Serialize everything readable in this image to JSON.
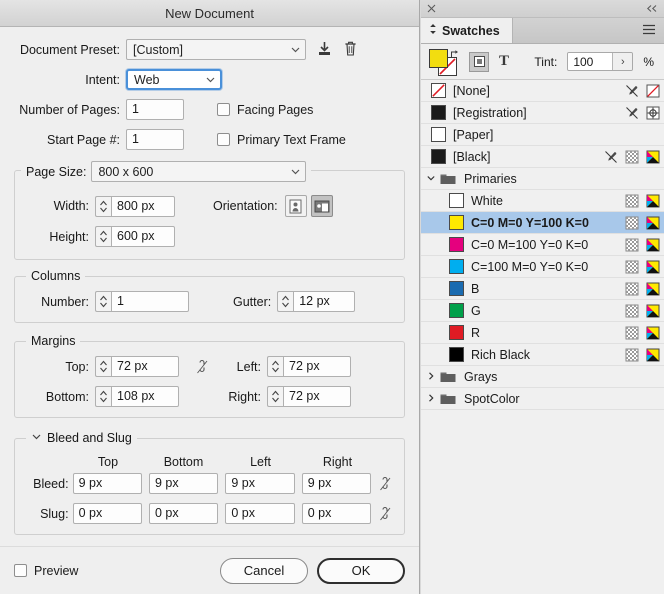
{
  "dialog": {
    "title": "New Document",
    "preset": {
      "label": "Document Preset:",
      "value": "[Custom]",
      "save_icon": "save-preset-icon",
      "delete_icon": "trash-icon"
    },
    "intent": {
      "label": "Intent:",
      "value": "Web"
    },
    "number_of_pages": {
      "label": "Number of Pages:",
      "value": "1"
    },
    "start_page": {
      "label": "Start Page #:",
      "value": "1"
    },
    "facing_pages": {
      "label": "Facing Pages",
      "checked": false
    },
    "primary_text_frame": {
      "label": "Primary Text Frame",
      "checked": false
    },
    "page_size": {
      "label": "Page Size:",
      "value": "800 x 600",
      "width": {
        "label": "Width:",
        "value": "800 px"
      },
      "height": {
        "label": "Height:",
        "value": "600 px"
      },
      "orientation": {
        "label": "Orientation:",
        "portrait_icon": "portrait-icon",
        "landscape_icon": "landscape-icon",
        "selected": "landscape"
      }
    },
    "columns": {
      "title": "Columns",
      "number": {
        "label": "Number:",
        "value": "1"
      },
      "gutter": {
        "label": "Gutter:",
        "value": "12 px"
      }
    },
    "margins": {
      "title": "Margins",
      "top": {
        "label": "Top:",
        "value": "72 px"
      },
      "bottom": {
        "label": "Bottom:",
        "value": "108 px"
      },
      "left": {
        "label": "Left:",
        "value": "72 px"
      },
      "right": {
        "label": "Right:",
        "value": "72 px"
      },
      "link_icon": "broken-chain-icon"
    },
    "bleed_slug": {
      "title": "Bleed and Slug",
      "collapsed": false,
      "columns": [
        "Top",
        "Bottom",
        "Left",
        "Right"
      ],
      "bleed": {
        "label": "Bleed:",
        "values": [
          "9 px",
          "9 px",
          "9 px",
          "9 px"
        ],
        "link_icon": "broken-chain-icon"
      },
      "slug": {
        "label": "Slug:",
        "values": [
          "0 px",
          "0 px",
          "0 px",
          "0 px"
        ],
        "link_icon": "broken-chain-icon"
      }
    },
    "footer": {
      "preview": {
        "label": "Preview",
        "checked": false
      },
      "cancel": "Cancel",
      "ok": "OK"
    }
  },
  "panel": {
    "close_icon": "close-icon",
    "collapse_icon": "collapse-double-chevron-icon",
    "tab": {
      "label": "Swatches",
      "icon": "panel-toggle-icon"
    },
    "menu_icon": "panel-menu-icon",
    "tools": {
      "fill_color": "#f2dd10",
      "stroke_color": "none",
      "fill_icon": "fill-swatch-icon",
      "stroke_icon": "stroke-swatch-icon",
      "swap_icon": "swap-fill-stroke-icon",
      "formatting_container_icon": "formatting-affects-container-icon",
      "formatting_text_icon": "formatting-affects-text-icon",
      "tint": {
        "label": "Tint:",
        "value": "100",
        "unit": "%",
        "arrow_icon": "tint-dropdown-icon"
      }
    },
    "swatches": [
      {
        "name": "[None]",
        "chip": "none",
        "type": "row",
        "icons": [
          "eyedropper-crossed-icon",
          "none-slash-icon"
        ]
      },
      {
        "name": "[Registration]",
        "chip": "#1a1a1a",
        "type": "row",
        "icons": [
          "eyedropper-crossed-icon",
          "registration-target-icon"
        ]
      },
      {
        "name": "[Paper]",
        "chip": "#ffffff",
        "type": "row",
        "icons": []
      },
      {
        "name": "[Black]",
        "chip": "#1a1a1a",
        "type": "row",
        "icons": [
          "eyedropper-crossed-icon",
          "checkerboard-icon",
          "cmyk-icon"
        ]
      },
      {
        "name": "Primaries",
        "type": "group",
        "expanded": true,
        "icon": "folder-icon"
      },
      {
        "name": "White",
        "chip": "#ffffff",
        "type": "row",
        "indent": true,
        "icons": [
          "checkerboard-icon",
          "cmyk-icon"
        ]
      },
      {
        "name": "C=0 M=0 Y=100 K=0",
        "chip": "#ffe900",
        "type": "row",
        "indent": true,
        "selected": true,
        "icons": [
          "checkerboard-icon",
          "cmyk-icon"
        ]
      },
      {
        "name": "C=0 M=100 Y=0 K=0",
        "chip": "#e5007e",
        "type": "row",
        "indent": true,
        "icons": [
          "checkerboard-icon",
          "cmyk-icon"
        ]
      },
      {
        "name": "C=100 M=0 Y=0 K=0",
        "chip": "#00aeef",
        "type": "row",
        "indent": true,
        "icons": [
          "checkerboard-icon",
          "cmyk-icon"
        ]
      },
      {
        "name": "B",
        "chip": "#1a6bb0",
        "type": "row",
        "indent": true,
        "icons": [
          "checkerboard-icon",
          "cmyk-icon"
        ]
      },
      {
        "name": "G",
        "chip": "#00a04a",
        "type": "row",
        "indent": true,
        "icons": [
          "checkerboard-icon",
          "cmyk-icon"
        ]
      },
      {
        "name": "R",
        "chip": "#e01b24",
        "type": "row",
        "indent": true,
        "icons": [
          "checkerboard-icon",
          "cmyk-icon"
        ]
      },
      {
        "name": "Rich Black",
        "chip": "#000000",
        "type": "row",
        "indent": true,
        "icons": [
          "checkerboard-icon",
          "cmyk-icon"
        ]
      },
      {
        "name": "Grays",
        "type": "group",
        "expanded": false,
        "icon": "folder-icon"
      },
      {
        "name": "SpotColor",
        "type": "group",
        "expanded": false,
        "icon": "folder-icon"
      }
    ]
  },
  "colors": {
    "selection_blue": "#a8c8ea",
    "focus_blue": "#4a90d9",
    "dialog_bg": "#efefef",
    "panel_bg": "#f0f0f0"
  }
}
